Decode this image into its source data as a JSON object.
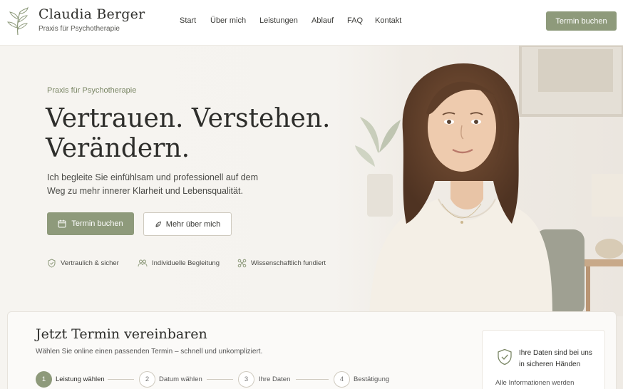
{
  "brand": {
    "name": "Claudia Berger",
    "subtitle": "Praxis für Psychotherapie"
  },
  "nav": {
    "items": [
      "Start",
      "Über mich",
      "Leistungen",
      "Ablauf",
      "FAQ",
      "Kontakt"
    ]
  },
  "header": {
    "cta_label": "Termin buchen"
  },
  "hero": {
    "kicker": "Praxis für Psychotherapie",
    "title_line1": "Vertrauen. Verstehen.",
    "title_line2": "Verändern.",
    "text": "Ich begleite Sie einfühlsam und professionell auf dem Weg zu mehr innerer Klarheit und Lebensqualität.",
    "primary_button": "Termin buchen",
    "secondary_button": "Mehr über mich",
    "features": [
      "Vertraulich & sicher",
      "Individuelle Begleitung",
      "Wissenschaftlich fundiert"
    ]
  },
  "booking": {
    "title": "Jetzt Termin vereinbaren",
    "subtitle": "Wählen Sie online einen passenden Termin – schnell und unkompliziert.",
    "steps": [
      {
        "number": "1",
        "label": "Leistung wählen",
        "active": true
      },
      {
        "number": "2",
        "label": "Datum wählen",
        "active": false
      },
      {
        "number": "3",
        "label": "Ihre Daten",
        "active": false
      },
      {
        "number": "4",
        "label": "Bestätigung",
        "active": false
      }
    ],
    "privacy_title": "Ihre Daten sind bei uns in sicheren Händen",
    "privacy_text": "Alle Informationen werden"
  },
  "colors": {
    "accent": "#8e9a7b",
    "text": "#2e2e2b",
    "background": "#f7f5f1"
  }
}
